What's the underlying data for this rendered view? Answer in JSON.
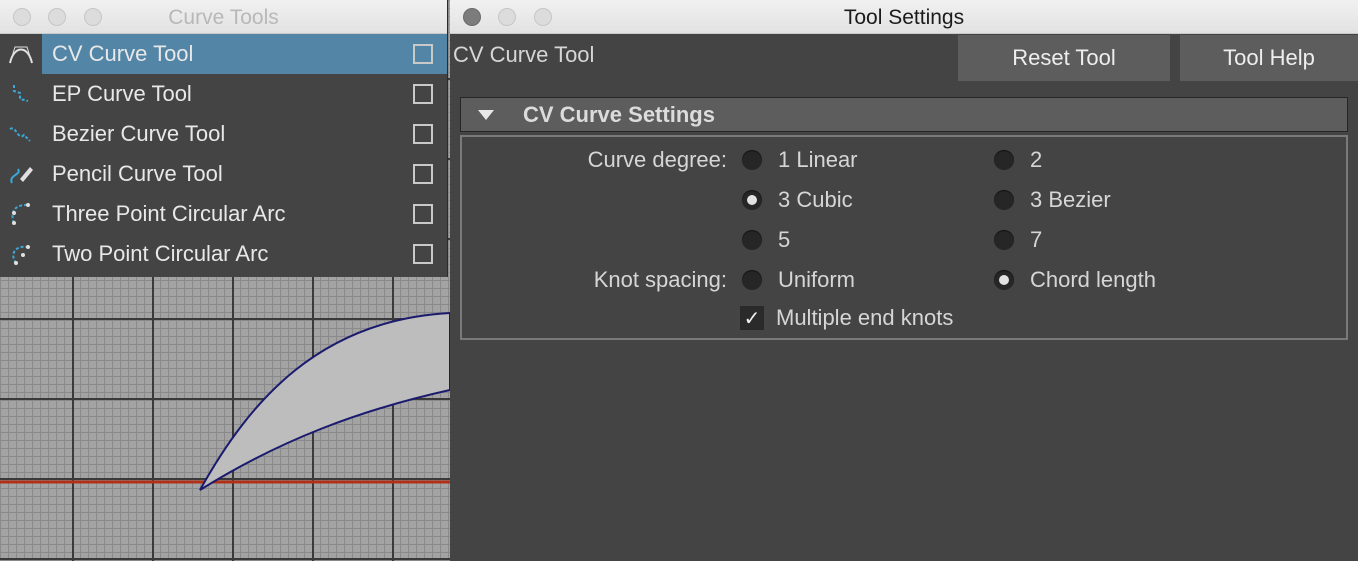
{
  "curve_tools_window": {
    "title": "Curve Tools",
    "items": [
      {
        "label": "CV Curve Tool",
        "icon": "cv-curve-icon",
        "selected": true
      },
      {
        "label": "EP Curve Tool",
        "icon": "ep-curve-icon",
        "selected": false
      },
      {
        "label": "Bezier Curve Tool",
        "icon": "bezier-curve-icon",
        "selected": false
      },
      {
        "label": "Pencil Curve Tool",
        "icon": "pencil-curve-icon",
        "selected": false
      },
      {
        "label": "Three Point Circular Arc",
        "icon": "three-point-arc-icon",
        "selected": false
      },
      {
        "label": "Two Point Circular Arc",
        "icon": "two-point-arc-icon",
        "selected": false
      }
    ]
  },
  "tool_settings_window": {
    "title": "Tool Settings",
    "tool_name": "CV Curve Tool",
    "reset_button": "Reset Tool",
    "help_button": "Tool Help",
    "section": {
      "title": "CV Curve Settings",
      "expanded": true,
      "curve_degree_label": "Curve degree:",
      "curve_degree_options": [
        "1 Linear",
        "2",
        "3 Cubic",
        "3 Bezier",
        "5",
        "7"
      ],
      "curve_degree_selected": "3 Cubic",
      "knot_spacing_label": "Knot spacing:",
      "knot_spacing_options": [
        "Uniform",
        "Chord length"
      ],
      "knot_spacing_selected": "Chord length",
      "multiple_end_knots_label": "Multiple end knots",
      "multiple_end_knots_checked": true
    }
  },
  "colors": {
    "selection": "#5285a6",
    "panel_bg": "#444444",
    "button_bg": "#5d5d5d",
    "curve_outline": "#1a1a6e",
    "grid_axis": "#b03018"
  }
}
